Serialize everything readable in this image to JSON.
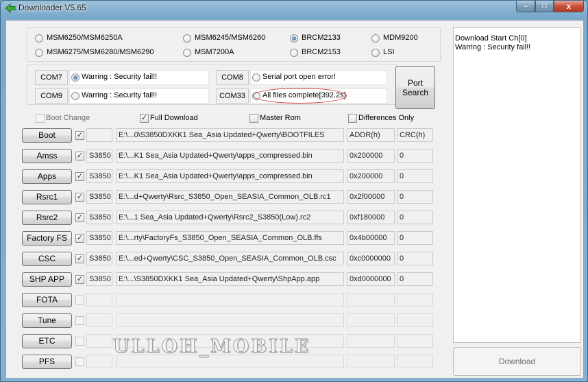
{
  "window": {
    "title": "Downloader V5.65"
  },
  "title_controls": {
    "minimize": "–",
    "maximize": "□",
    "close": "x"
  },
  "chipsets": [
    {
      "label": "MSM6250/MSM6250A",
      "selected": false
    },
    {
      "label": "MSM6245/MSM6260",
      "selected": false
    },
    {
      "label": "BRCM2133",
      "selected": true
    },
    {
      "label": "MDM9200",
      "selected": false
    },
    {
      "label": "MSM6275/MSM6280/MSM6290",
      "selected": false
    },
    {
      "label": "MSM7200A",
      "selected": false
    },
    {
      "label": "BRCM2153",
      "selected": false
    },
    {
      "label": "LSI",
      "selected": false
    }
  ],
  "ports": [
    {
      "name": "COM7",
      "status": "Warring : Security fail!!",
      "selected": true
    },
    {
      "name": "COM8",
      "status": "Serial port open error!",
      "selected": false
    },
    {
      "name": "COM9",
      "status": "Warring : Security fail!!",
      "selected": false
    },
    {
      "name": "COM33",
      "status": "All files complete[392.2s]",
      "selected": false
    }
  ],
  "port_search": {
    "line1": "Port",
    "line2": "Search"
  },
  "options": [
    {
      "label": "Boot Change",
      "checked": false,
      "enabled": false
    },
    {
      "label": "Full Download",
      "checked": true,
      "enabled": true
    },
    {
      "label": "Master Rom",
      "checked": false,
      "enabled": true
    },
    {
      "label": "Differences Only",
      "checked": false,
      "enabled": true
    }
  ],
  "file_rows": [
    {
      "button": "Boot",
      "checked": true,
      "model": "",
      "path": "E:\\...0\\S3850DXKK1 Sea_Asia Updated+Qwerty\\BOOTFILES",
      "addr": "ADDR(h)",
      "crc": "CRC(h)"
    },
    {
      "button": "Amss",
      "checked": true,
      "model": "S3850",
      "path": "E:\\...K1 Sea_Asia Updated+Qwerty\\apps_compressed.bin",
      "addr": "0x200000",
      "crc": "0"
    },
    {
      "button": "Apps",
      "checked": true,
      "model": "S3850",
      "path": "E:\\...K1 Sea_Asia Updated+Qwerty\\apps_compressed.bin",
      "addr": "0x200000",
      "crc": "0"
    },
    {
      "button": "Rsrc1",
      "checked": true,
      "model": "S3850",
      "path": "E:\\...d+Qwerty\\Rsrc_S3850_Open_SEASIA_Common_OLB.rc1",
      "addr": "0x2f00000",
      "crc": "0"
    },
    {
      "button": "Rsrc2",
      "checked": true,
      "model": "S3850",
      "path": "E:\\...1 Sea_Asia Updated+Qwerty\\Rsrc2_S3850(Low).rc2",
      "addr": "0xf180000",
      "crc": "0"
    },
    {
      "button": "Factory FS",
      "checked": true,
      "model": "S3850",
      "path": "E:\\...rty\\FactoryFs_S3850_Open_SEASIA_Common_OLB.ffs",
      "addr": "0x4b00000",
      "crc": "0"
    },
    {
      "button": "CSC",
      "checked": true,
      "model": "S3850",
      "path": "E:\\...ed+Qwerty\\CSC_S3850_Open_SEASIA_Common_OLB.csc",
      "addr": "0xc0000000",
      "crc": "0"
    },
    {
      "button": "SHP APP",
      "checked": true,
      "model": "S3850",
      "path": "E:\\...\\S3850DXKK1 Sea_Asia Updated+Qwerty\\ShpApp.app",
      "addr": "0xd0000000",
      "crc": "0"
    },
    {
      "button": "FOTA",
      "checked": false,
      "model": "",
      "path": "",
      "addr": "",
      "crc": ""
    },
    {
      "button": "Tune",
      "checked": false,
      "model": "",
      "path": "",
      "addr": "",
      "crc": ""
    },
    {
      "button": "ETC",
      "checked": false,
      "model": "",
      "path": "",
      "addr": "",
      "crc": ""
    },
    {
      "button": "PFS",
      "checked": false,
      "model": "",
      "path": "",
      "addr": "",
      "crc": ""
    }
  ],
  "log": {
    "line1": "Download Start Ch[0]",
    "line2": "Warring : Security fail!!"
  },
  "download_button": "Download",
  "watermark": "ULLOH_MOBILE",
  "colors": {
    "accent": "#1d5a93",
    "highlight_ring": "#d23a3a",
    "frame": "#7aa9cc"
  }
}
